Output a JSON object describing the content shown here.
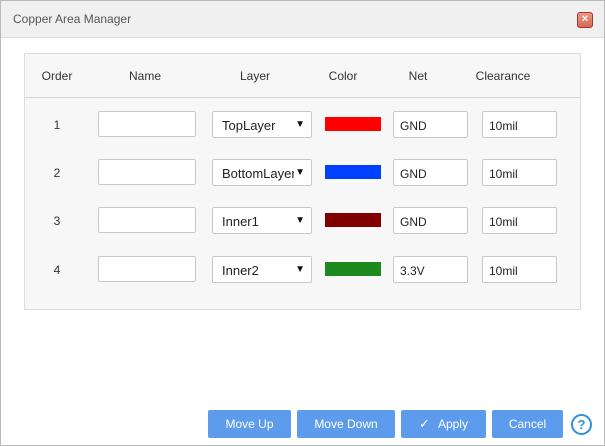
{
  "dialog": {
    "title": "Copper Area Manager"
  },
  "table": {
    "headers": {
      "order": "Order",
      "name": "Name",
      "layer": "Layer",
      "color": "Color",
      "net": "Net",
      "clearance": "Clearance"
    },
    "rows": [
      {
        "order": "1",
        "name": "",
        "layer": "TopLayer",
        "color": "#ff0000",
        "net": "GND",
        "clearance": "10mil"
      },
      {
        "order": "2",
        "name": "",
        "layer": "BottomLayer",
        "color": "#0040ff",
        "net": "GND",
        "clearance": "10mil"
      },
      {
        "order": "3",
        "name": "",
        "layer": "Inner1",
        "color": "#800000",
        "net": "GND",
        "clearance": "10mil"
      },
      {
        "order": "4",
        "name": "",
        "layer": "Inner2",
        "color": "#1e8a1e",
        "net": "3.3V",
        "clearance": "10mil"
      }
    ]
  },
  "buttons": {
    "move_up": "Move Up",
    "move_down": "Move Down",
    "apply": "Apply",
    "cancel": "Cancel",
    "help": "?"
  },
  "icons": {
    "close": "close-icon",
    "apply_check": "check-icon",
    "help": "help-icon",
    "dropdown": "chevron-down-icon"
  },
  "colors": {
    "accent": "#5d9cec",
    "help": "#2f8fe0"
  }
}
